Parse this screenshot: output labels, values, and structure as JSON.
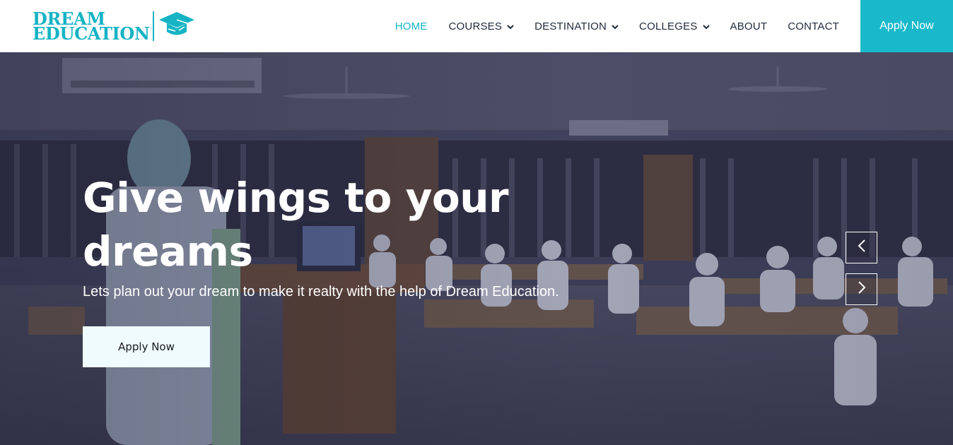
{
  "logo": {
    "line1": "DREAM",
    "line2": "EDUCATION",
    "icon": "graduation-cap-icon",
    "color": "#15b3c4"
  },
  "nav": {
    "items": [
      {
        "label": "HOME",
        "active": true,
        "dropdown": false
      },
      {
        "label": "COURSES",
        "active": false,
        "dropdown": true
      },
      {
        "label": "DESTINATION",
        "active": false,
        "dropdown": true
      },
      {
        "label": "COLLEGES",
        "active": false,
        "dropdown": true
      },
      {
        "label": "ABOUT",
        "active": false,
        "dropdown": false
      },
      {
        "label": "CONTACT",
        "active": false,
        "dropdown": false
      }
    ],
    "apply_label": "Apply Now",
    "accent_color": "#19b9cb"
  },
  "hero": {
    "title": "Give wings to your dreams",
    "subtitle": "Lets plan out your dream to make it realty with the help of Dream Education.",
    "button_label": "Apply Now",
    "prev_icon": "chevron-left-icon",
    "next_icon": "chevron-right-icon",
    "background": "classroom-photo"
  }
}
